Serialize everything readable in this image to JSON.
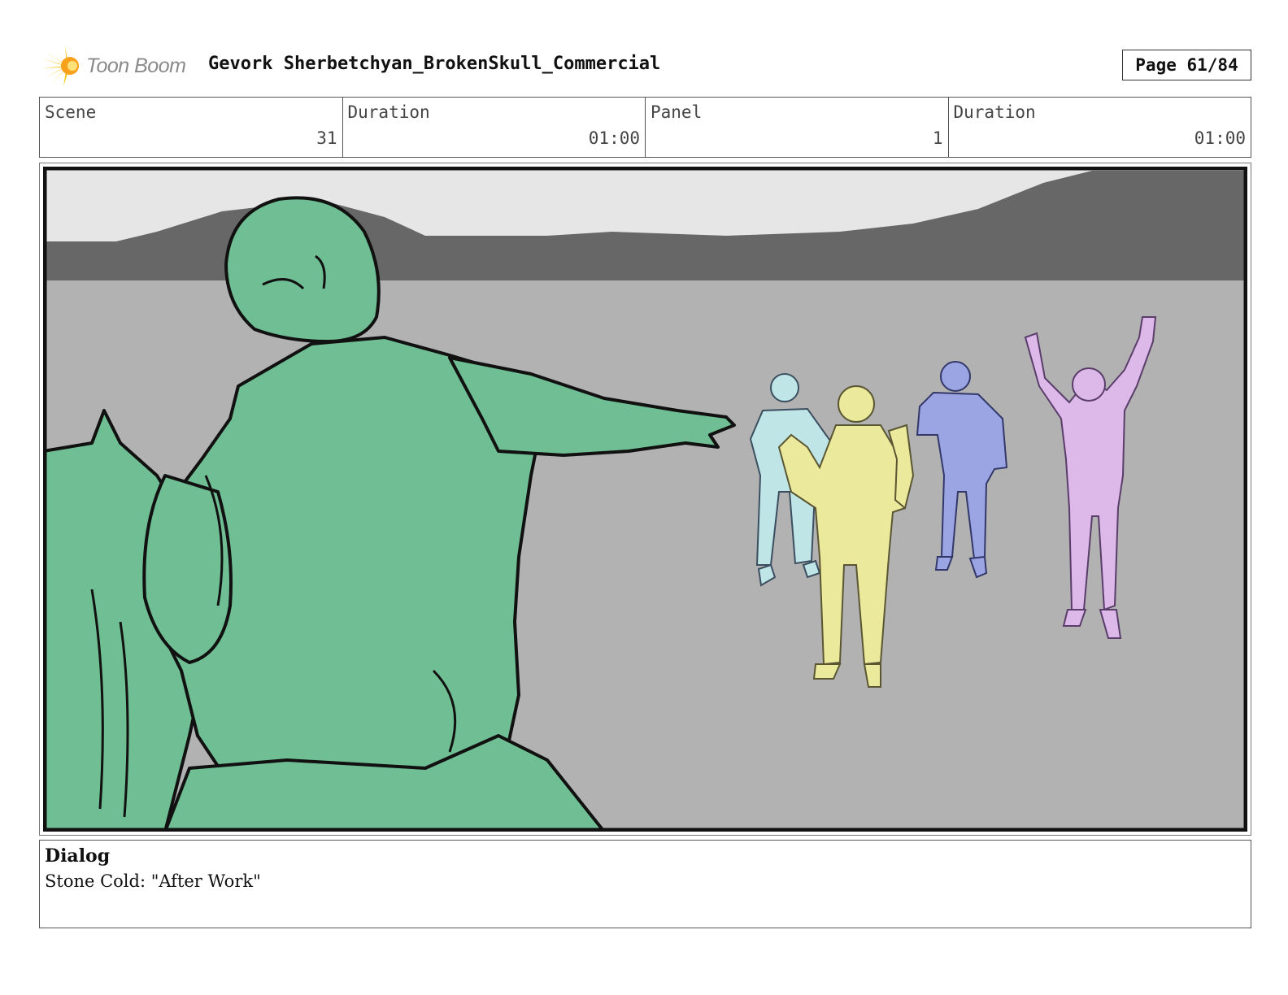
{
  "header": {
    "logo_text": "Toon Boom",
    "title": "Gevork Sherbetchyan_BrokenSkull_Commercial",
    "page": "Page 61/84"
  },
  "info": {
    "scene_label": "Scene",
    "scene_value": "31",
    "scene_duration_label": "Duration",
    "scene_duration_value": "01:00",
    "panel_label": "Panel",
    "panel_value": "1",
    "panel_duration_label": "Duration",
    "panel_duration_value": "01:00"
  },
  "dialog": {
    "title": "Dialog",
    "text": "Stone Cold: \"After Work\""
  },
  "colors": {
    "sky": "#e6e6e6",
    "mountains": "#676767",
    "ground": "#b2b2b2",
    "stone_cold": "#70be93",
    "figure_cyan": "#bfe5e6",
    "figure_yellow": "#ebe99b",
    "figure_blue": "#9ba5e3",
    "figure_violet": "#dcb9e8",
    "logo_accent": "#f5c518"
  },
  "icons": {
    "logo": "toon-boom-starburst-icon"
  }
}
